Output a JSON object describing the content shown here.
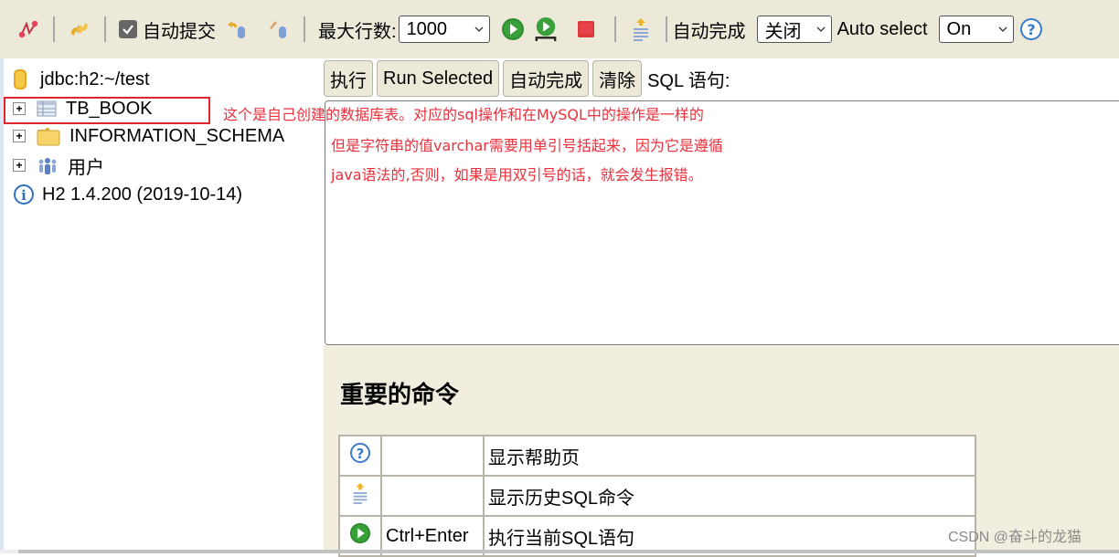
{
  "toolbar": {
    "icons": [
      "disconnect-icon",
      "refresh-icon"
    ],
    "autocommit_label": "自动提交",
    "autocommit_checked": true,
    "rollback_icon": "rollback-icon",
    "commit_icon": "commit-icon",
    "max_rows_label": "最大行数:",
    "max_rows_value": "1000",
    "run_icon": "run-icon",
    "run_selected_icon": "run-selected-icon",
    "stop_icon": "stop-icon",
    "history_icon": "history-icon",
    "autocomplete_label": "自动完成",
    "autocomplete_value": "关闭",
    "auto_select_label": "Auto select",
    "auto_select_value": "On",
    "help_icon": "help-icon"
  },
  "tree": {
    "connection": "jdbc:h2:~/test",
    "items": [
      {
        "label": "TB_BOOK",
        "icon": "table-icon"
      },
      {
        "label": "INFORMATION_SCHEMA",
        "icon": "folder-icon"
      },
      {
        "label": "用户",
        "icon": "users-icon"
      }
    ],
    "version": "H2 1.4.200 (2019-10-14)"
  },
  "sql_toolbar": {
    "execute": "执行",
    "run_selected": "Run Selected",
    "autocomplete": "自动完成",
    "clear": "清除",
    "sql_label": "SQL 语句:"
  },
  "annotations": [
    "这个是自己创建的数据库表。对应的sql操作和在MySQL中的操作是一样的",
    "但是字符串的值varchar需要用单引号括起来，因为它是遵循",
    "java语法的,否则，如果是用双引号的话，就会发生报错。"
  ],
  "help": {
    "title": "重要的命令",
    "rows": [
      {
        "icon": "help-icon",
        "key": "",
        "desc": "显示帮助页"
      },
      {
        "icon": "history-icon",
        "key": "",
        "desc": "显示历史SQL命令"
      },
      {
        "icon": "run-icon",
        "key": "Ctrl+Enter",
        "desc": "执行当前SQL语句"
      }
    ]
  },
  "watermark": "CSDN @奋斗的龙猫",
  "colors": {
    "toolbar_bg": "#ece9d8",
    "annotation": "#e8313d",
    "help_bg": "#f2eedf"
  }
}
